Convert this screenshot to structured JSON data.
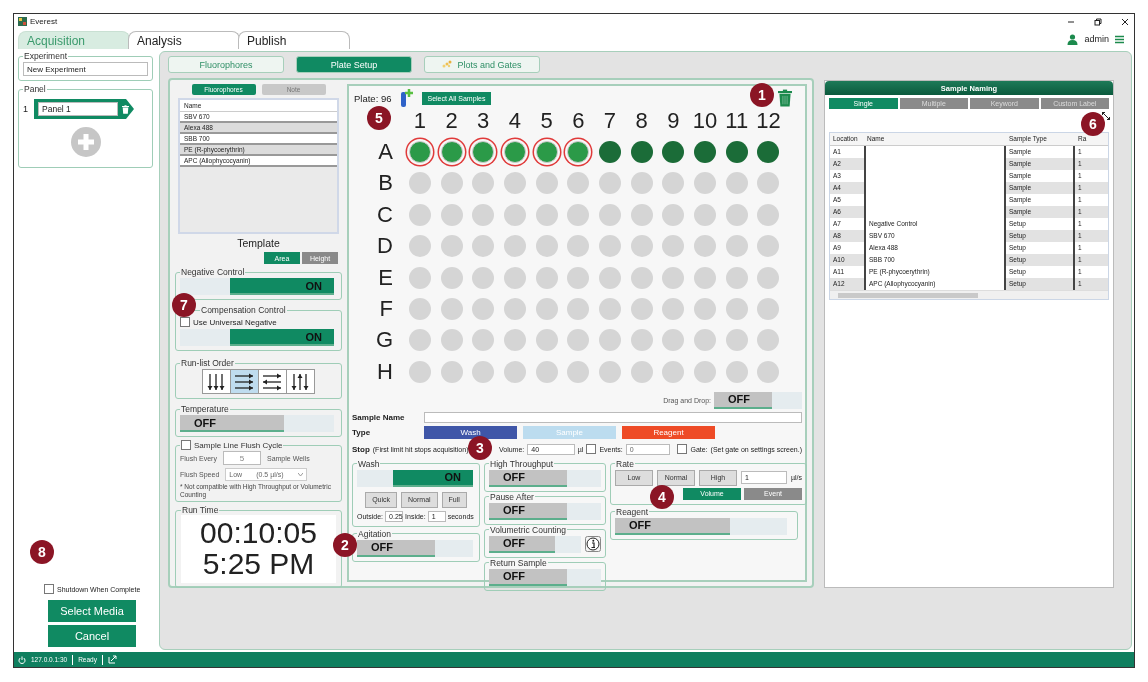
{
  "window": {
    "title": "Everest"
  },
  "main_tabs": [
    {
      "label": "Acquisition",
      "selected": true
    },
    {
      "label": "Analysis",
      "selected": false
    },
    {
      "label": "Publish",
      "selected": false
    }
  ],
  "user": {
    "name": "admin"
  },
  "experiment": {
    "label": "Experiment",
    "value": "New Experiment"
  },
  "panel": {
    "label": "Panel",
    "items": [
      {
        "index": "1",
        "name": "Panel 1"
      }
    ]
  },
  "shutdown": {
    "label": "Shutdown When Complete",
    "checked": false
  },
  "side_buttons": [
    "Select Media",
    "Cancel"
  ],
  "status_bar": {
    "address": "127.0.0.1:30",
    "status": "Ready"
  },
  "sub_tabs": [
    {
      "label": "Fluorophores",
      "selected": false
    },
    {
      "label": "Plate Setup",
      "selected": true
    },
    {
      "label": "Plots and Gates",
      "selected": false
    }
  ],
  "fluor_tabs": [
    {
      "label": "Fluorophores",
      "selected": true
    },
    {
      "label": "Note",
      "selected": false
    }
  ],
  "fluor_list": {
    "header": "Name",
    "rows": [
      "SBV 670",
      "Alexa 488",
      "SBB 700",
      "PE (R-phycoerythrin)",
      "APC (Allophycocyanin)"
    ]
  },
  "template": {
    "label": "Template",
    "options": [
      {
        "label": "Area",
        "selected": true
      },
      {
        "label": "Height",
        "selected": false
      }
    ]
  },
  "negative_control": {
    "label": "Negative Control",
    "toggle": {
      "on": true,
      "text": "ON"
    }
  },
  "compensation_control": {
    "label": "Compensation Control",
    "checkbox": {
      "label": "Use Universal Negative",
      "checked": false
    },
    "toggle": {
      "on": true,
      "text": "ON"
    }
  },
  "run_list_order": {
    "label": "Run-list Order",
    "options": [
      {
        "kind": "down",
        "selected": false
      },
      {
        "kind": "right",
        "selected": true
      },
      {
        "kind": "alternate",
        "selected": false
      },
      {
        "kind": "updown",
        "selected": false
      }
    ]
  },
  "temperature": {
    "label": "Temperature",
    "toggle": {
      "on": false,
      "text": "OFF"
    }
  },
  "flush_cycle": {
    "label": "Sample Line Flush Cycle",
    "checked": false,
    "every_label": "Flush Every",
    "every_value": "5",
    "every_unit": "Sample Wells",
    "speed_label": "Flush Speed",
    "speed_value": "Low",
    "speed_rate": "(0.5 µl/s)",
    "note": "* Not compatible with High Throughput or Volumetric Counting"
  },
  "run_time": {
    "label": "Run Time",
    "elapsed": "00:10:05",
    "clock": "5:25 PM"
  },
  "plate": {
    "title": "Plate: 96",
    "select_all": "Select All Samples",
    "columns": [
      "1",
      "2",
      "3",
      "4",
      "5",
      "6",
      "7",
      "8",
      "9",
      "10",
      "11",
      "12"
    ],
    "rows": [
      {
        "label": "A",
        "wells": [
          {
            "filled": true,
            "selected": true
          },
          {
            "filled": true,
            "selected": true
          },
          {
            "filled": true,
            "selected": true
          },
          {
            "filled": true,
            "selected": true
          },
          {
            "filled": true,
            "selected": true
          },
          {
            "filled": true,
            "selected": true
          },
          {
            "filled": true,
            "selected": false
          },
          {
            "filled": true,
            "selected": false
          },
          {
            "filled": true,
            "selected": false
          },
          {
            "filled": true,
            "selected": false
          },
          {
            "filled": true,
            "selected": false
          },
          {
            "filled": true,
            "selected": false
          }
        ]
      },
      {
        "label": "B",
        "wells": [
          {
            "filled": false,
            "selected": false
          },
          {
            "filled": false,
            "selected": false
          },
          {
            "filled": false,
            "selected": false
          },
          {
            "filled": false,
            "selected": false
          },
          {
            "filled": false,
            "selected": false
          },
          {
            "filled": false,
            "selected": false
          },
          {
            "filled": false,
            "selected": false
          },
          {
            "filled": false,
            "selected": false
          },
          {
            "filled": false,
            "selected": false
          },
          {
            "filled": false,
            "selected": false
          },
          {
            "filled": false,
            "selected": false
          },
          {
            "filled": false,
            "selected": false
          }
        ]
      },
      {
        "label": "C",
        "wells": [
          {
            "filled": false,
            "selected": false
          },
          {
            "filled": false,
            "selected": false
          },
          {
            "filled": false,
            "selected": false
          },
          {
            "filled": false,
            "selected": false
          },
          {
            "filled": false,
            "selected": false
          },
          {
            "filled": false,
            "selected": false
          },
          {
            "filled": false,
            "selected": false
          },
          {
            "filled": false,
            "selected": false
          },
          {
            "filled": false,
            "selected": false
          },
          {
            "filled": false,
            "selected": false
          },
          {
            "filled": false,
            "selected": false
          },
          {
            "filled": false,
            "selected": false
          }
        ]
      },
      {
        "label": "D",
        "wells": [
          {
            "filled": false,
            "selected": false
          },
          {
            "filled": false,
            "selected": false
          },
          {
            "filled": false,
            "selected": false
          },
          {
            "filled": false,
            "selected": false
          },
          {
            "filled": false,
            "selected": false
          },
          {
            "filled": false,
            "selected": false
          },
          {
            "filled": false,
            "selected": false
          },
          {
            "filled": false,
            "selected": false
          },
          {
            "filled": false,
            "selected": false
          },
          {
            "filled": false,
            "selected": false
          },
          {
            "filled": false,
            "selected": false
          },
          {
            "filled": false,
            "selected": false
          }
        ]
      },
      {
        "label": "E",
        "wells": [
          {
            "filled": false,
            "selected": false
          },
          {
            "filled": false,
            "selected": false
          },
          {
            "filled": false,
            "selected": false
          },
          {
            "filled": false,
            "selected": false
          },
          {
            "filled": false,
            "selected": false
          },
          {
            "filled": false,
            "selected": false
          },
          {
            "filled": false,
            "selected": false
          },
          {
            "filled": false,
            "selected": false
          },
          {
            "filled": false,
            "selected": false
          },
          {
            "filled": false,
            "selected": false
          },
          {
            "filled": false,
            "selected": false
          },
          {
            "filled": false,
            "selected": false
          }
        ]
      },
      {
        "label": "F",
        "wells": [
          {
            "filled": false,
            "selected": false
          },
          {
            "filled": false,
            "selected": false
          },
          {
            "filled": false,
            "selected": false
          },
          {
            "filled": false,
            "selected": false
          },
          {
            "filled": false,
            "selected": false
          },
          {
            "filled": false,
            "selected": false
          },
          {
            "filled": false,
            "selected": false
          },
          {
            "filled": false,
            "selected": false
          },
          {
            "filled": false,
            "selected": false
          },
          {
            "filled": false,
            "selected": false
          },
          {
            "filled": false,
            "selected": false
          },
          {
            "filled": false,
            "selected": false
          }
        ]
      },
      {
        "label": "G",
        "wells": [
          {
            "filled": false,
            "selected": false
          },
          {
            "filled": false,
            "selected": false
          },
          {
            "filled": false,
            "selected": false
          },
          {
            "filled": false,
            "selected": false
          },
          {
            "filled": false,
            "selected": false
          },
          {
            "filled": false,
            "selected": false
          },
          {
            "filled": false,
            "selected": false
          },
          {
            "filled": false,
            "selected": false
          },
          {
            "filled": false,
            "selected": false
          },
          {
            "filled": false,
            "selected": false
          },
          {
            "filled": false,
            "selected": false
          },
          {
            "filled": false,
            "selected": false
          }
        ]
      },
      {
        "label": "H",
        "wells": [
          {
            "filled": false,
            "selected": false
          },
          {
            "filled": false,
            "selected": false
          },
          {
            "filled": false,
            "selected": false
          },
          {
            "filled": false,
            "selected": false
          },
          {
            "filled": false,
            "selected": false
          },
          {
            "filled": false,
            "selected": false
          },
          {
            "filled": false,
            "selected": false
          },
          {
            "filled": false,
            "selected": false
          },
          {
            "filled": false,
            "selected": false
          },
          {
            "filled": false,
            "selected": false
          },
          {
            "filled": false,
            "selected": false
          },
          {
            "filled": false,
            "selected": false
          }
        ]
      }
    ]
  },
  "drag_drop": {
    "label": "Drag and Drop:",
    "toggle": {
      "on": false,
      "text": "OFF"
    }
  },
  "sample_name": {
    "label": "Sample Name"
  },
  "type": {
    "label": "Type",
    "options": [
      {
        "label": "Wash",
        "color": "#3f56a8"
      },
      {
        "label": "Sample",
        "color": "#bcdcef"
      },
      {
        "label": "Reagent",
        "color": "#ee4b26"
      }
    ]
  },
  "stop": {
    "label": "Stop",
    "hint": "(First limit hit stops acquisition)",
    "volume_label": "Volume:",
    "volume_value": "40",
    "volume_unit": "µl",
    "events": {
      "label": "Events:",
      "checked": false,
      "value": "0"
    },
    "gate": {
      "label": "Gate:",
      "checked": false,
      "hint": "(Set gate on settings screen.)"
    }
  },
  "wash": {
    "label": "Wash",
    "toggle": {
      "on": true,
      "text": "ON"
    },
    "modes": [
      "Quick",
      "Normal",
      "Full"
    ],
    "outside_label": "Outside:",
    "outside_value": "0.25",
    "inside_label": "Inside:",
    "inside_value": "1",
    "unit": "seconds"
  },
  "agitation": {
    "label": "Agitation",
    "toggle": {
      "on": false,
      "text": "OFF"
    }
  },
  "options": [
    {
      "label": "High Throughput",
      "kind": "plain",
      "toggle": {
        "on": false,
        "text": "OFF"
      }
    },
    {
      "label": "Pause After",
      "kind": "plain",
      "toggle": {
        "on": false,
        "text": "OFF"
      }
    },
    {
      "label": "Volumetric Counting",
      "kind": "info",
      "toggle": {
        "on": false,
        "text": "OFF"
      }
    },
    {
      "label": "Return Sample",
      "kind": "plain",
      "toggle": {
        "on": false,
        "text": "OFF"
      }
    }
  ],
  "rate": {
    "label": "Rate",
    "speeds": [
      "Low",
      "Normal",
      "High"
    ],
    "value": "1",
    "unit": "µl/s",
    "modes": [
      {
        "label": "Volume",
        "selected": true
      },
      {
        "label": "Event",
        "selected": false
      }
    ]
  },
  "reagent": {
    "label": "Reagent",
    "toggle": {
      "on": false,
      "text": "OFF"
    }
  },
  "sample_naming": {
    "title": "Sample Naming",
    "tabs": [
      {
        "label": "Single",
        "selected": true
      },
      {
        "label": "Multiple",
        "selected": false
      },
      {
        "label": "Keyword",
        "selected": false
      },
      {
        "label": "Custom Label",
        "selected": false
      }
    ],
    "columns": [
      "Location",
      "Name",
      "Sample Type",
      "Ra"
    ],
    "rows": [
      {
        "location": "A1",
        "type": "Sample",
        "column_4": "1"
      },
      {
        "location": "A2",
        "type": "Sample",
        "column_4": "1"
      },
      {
        "location": "A3",
        "type": "Sample",
        "column_4": "1"
      },
      {
        "location": "A4",
        "type": "Sample",
        "column_4": "1"
      },
      {
        "location": "A5",
        "type": "Sample",
        "column_4": "1"
      },
      {
        "location": "A6",
        "type": "Sample",
        "column_4": "1"
      },
      {
        "location": "A7",
        "name": "Negative Control",
        "type": "Setup",
        "column_4": "1"
      },
      {
        "location": "A8",
        "name": "SBV 670",
        "type": "Setup",
        "column_4": "1"
      },
      {
        "location": "A9",
        "name": "Alexa 488",
        "type": "Setup",
        "column_4": "1"
      },
      {
        "location": "A10",
        "name": "SBB 700",
        "type": "Setup",
        "column_4": "1"
      },
      {
        "location": "A11",
        "name": "PE (R-phycoerythrin)",
        "type": "Setup",
        "column_4": "1"
      },
      {
        "location": "A12",
        "name": "APC (Allophycocyanin)",
        "type": "Setup",
        "column_4": "1"
      }
    ]
  },
  "callouts": [
    "1",
    "2",
    "3",
    "4",
    "5",
    "6",
    "7",
    "8"
  ]
}
